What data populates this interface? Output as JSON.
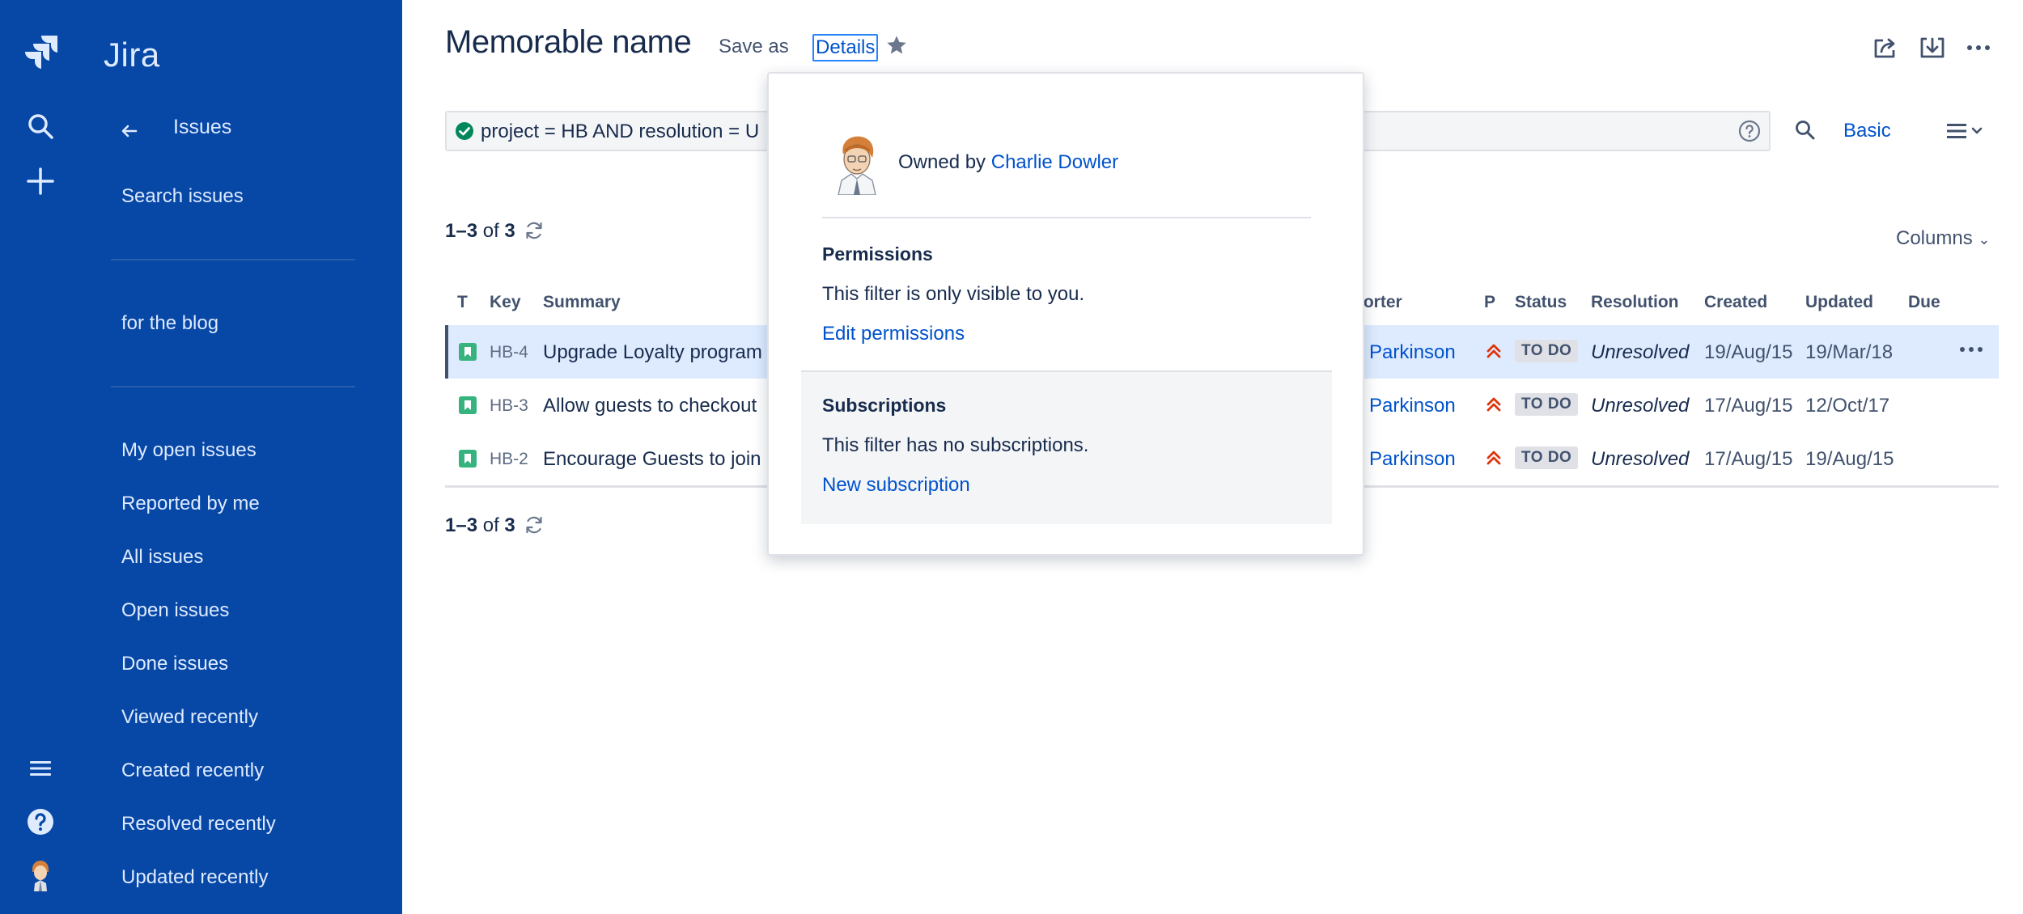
{
  "app": {
    "name": "Jira"
  },
  "sidebar": {
    "back_label": "Issues",
    "search_issues": "Search issues",
    "starred_filter": "for the blog",
    "items": [
      "My open issues",
      "Reported by me",
      "All issues",
      "Open issues",
      "Done issues",
      "Viewed recently",
      "Created recently",
      "Resolved recently",
      "Updated recently"
    ]
  },
  "header": {
    "title": "Memorable name",
    "save_as": "Save as",
    "details": "Details"
  },
  "search": {
    "jql": "project = HB AND resolution = U",
    "mode_toggle": "Basic"
  },
  "results": {
    "count_top": {
      "range": "1–3",
      "of": "of",
      "total": "3"
    },
    "count_bottom": {
      "range": "1–3",
      "of": "of",
      "total": "3"
    },
    "columns_button": "Columns",
    "headers": {
      "type": "T",
      "key": "Key",
      "summary": "Summary",
      "reporter": "porter",
      "priority": "P",
      "status": "Status",
      "resolution": "Resolution",
      "created": "Created",
      "updated": "Updated",
      "due": "Due"
    },
    "rows": [
      {
        "key": "HB-4",
        "summary": "Upgrade Loyalty program",
        "reporter": "n Parkinson",
        "status": "TO DO",
        "resolution": "Unresolved",
        "created": "19/Aug/15",
        "updated": "19/Mar/18"
      },
      {
        "key": "HB-3",
        "summary": "Allow guests to checkout",
        "reporter": "n Parkinson",
        "status": "TO DO",
        "resolution": "Unresolved",
        "created": "17/Aug/15",
        "updated": "12/Oct/17"
      },
      {
        "key": "HB-2",
        "summary": "Encourage Guests to join",
        "reporter": "n Parkinson",
        "status": "TO DO",
        "resolution": "Unresolved",
        "created": "17/Aug/15",
        "updated": "19/Aug/15"
      }
    ]
  },
  "details_popup": {
    "owned_by": "Owned by",
    "owner": "Charlie Dowler",
    "permissions_heading": "Permissions",
    "permissions_text": "This filter is only visible to you.",
    "edit_permissions": "Edit permissions",
    "subscriptions_heading": "Subscriptions",
    "subscriptions_text": "This filter has no subscriptions.",
    "new_subscription": "New subscription"
  },
  "icons": {
    "rail": [
      "jira-logo-icon",
      "search-icon",
      "create-icon",
      "menu-icon",
      "help-icon",
      "avatar"
    ],
    "toolbar": [
      "share-icon",
      "export-icon",
      "more-icon"
    ]
  },
  "colors": {
    "sidebar": "#0747A6",
    "link": "#0052CC",
    "selected_row": "#DEEBFF",
    "priority_highest": "#DE350B",
    "story": "#36B37E"
  }
}
